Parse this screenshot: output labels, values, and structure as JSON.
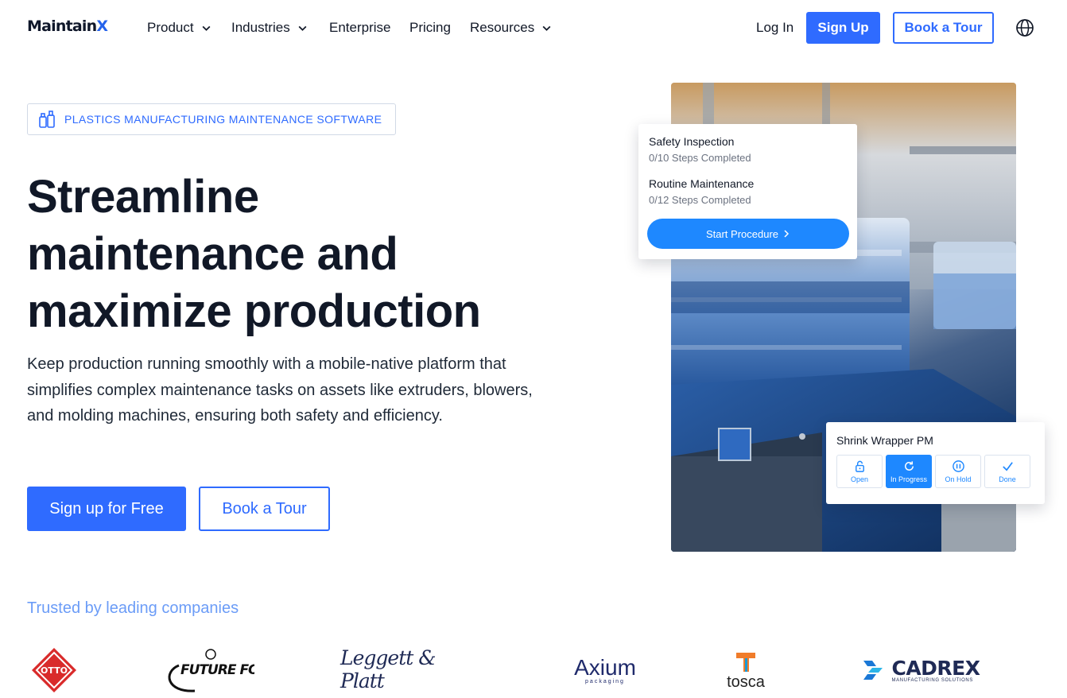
{
  "nav": {
    "logo_main": "Maintain",
    "logo_accent": "X",
    "items": [
      {
        "label": "Product",
        "dropdown": true
      },
      {
        "label": "Industries",
        "dropdown": true
      },
      {
        "label": "Enterprise",
        "dropdown": false
      },
      {
        "label": "Pricing",
        "dropdown": false
      },
      {
        "label": "Resources",
        "dropdown": true
      }
    ],
    "login": "Log In",
    "signup": "Sign Up",
    "book_tour": "Book a Tour",
    "globe_icon": "globe-icon"
  },
  "hero": {
    "badge": "PLASTICS MANUFACTURING MAINTENANCE SOFTWARE",
    "badge_icon": "bottles-icon",
    "headline": [
      "Streamline",
      "maintenance and",
      "maximize production"
    ],
    "lead": "Keep production running smoothly with a mobile-native platform that simplifies complex maintenance tasks on assets like extruders, blowers, and molding machines, ensuring both safety and efficiency.",
    "cta_primary": "Sign up for Free",
    "cta_secondary": "Book a Tour"
  },
  "procedure_card": {
    "items": [
      {
        "title": "Safety Inspection",
        "sub": "0/10 Steps Completed"
      },
      {
        "title": "Routine Maintenance",
        "sub": "0/12 Steps Completed"
      }
    ],
    "button": "Start Procedure"
  },
  "status_card": {
    "title": "Shrink Wrapper PM",
    "statuses": [
      {
        "label": "Open",
        "icon": "unlock-icon",
        "active": false
      },
      {
        "label": "In Progress",
        "icon": "refresh-icon",
        "active": true
      },
      {
        "label": "On Hold",
        "icon": "pause-icon",
        "active": false
      },
      {
        "label": "Done",
        "icon": "check-icon",
        "active": false
      }
    ]
  },
  "trusted": {
    "heading": "Trusted by leading companies",
    "brands": [
      {
        "name": "OTTO"
      },
      {
        "name": "FUTURE FOAM"
      },
      {
        "name": "Leggett & Platt"
      },
      {
        "name": "Axium",
        "sub": "packaging"
      },
      {
        "name": "tosca"
      },
      {
        "name": "CADREX",
        "sub": "MANUFACTURING SOLUTIONS"
      }
    ]
  },
  "colors": {
    "primary": "#2f6bff",
    "card_button": "#1e88ff",
    "trusted_text": "#6b9cf7",
    "otto_red": "#d92b2b",
    "axium_navy": "#1f2a6b",
    "tosca_orange": "#f07c2a",
    "cadrex_blue": "#1a78d6"
  }
}
